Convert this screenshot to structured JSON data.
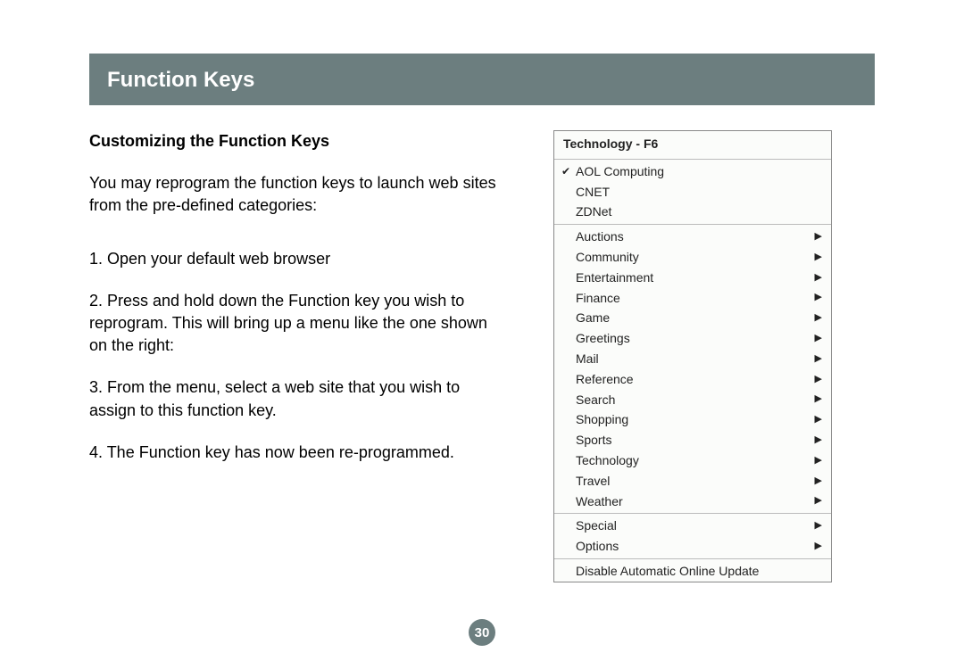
{
  "header": {
    "title": "Function Keys"
  },
  "subtitle": "Customizing the Function Keys",
  "intro": "You may reprogram the function keys to launch web sites from the pre-defined categories:",
  "steps": [
    "1. Open your default web browser",
    "2. Press and hold down the Function key you wish to reprogram. This will bring up a menu like the one shown on the right:",
    "3. From the menu, select a web site that you wish to assign to this function key.",
    "4. The Function key has now been re-programmed."
  ],
  "menu": {
    "title": "Technology - F6",
    "topItems": [
      {
        "label": "AOL Computing",
        "checked": true
      },
      {
        "label": "CNET",
        "checked": false
      },
      {
        "label": "ZDNet",
        "checked": false
      }
    ],
    "categories": [
      "Auctions",
      "Community",
      "Entertainment",
      "Finance",
      "Game",
      "Greetings",
      "Mail",
      "Reference",
      "Search",
      "Shopping",
      "Sports",
      "Technology",
      "Travel",
      "Weather"
    ],
    "bottomItems": [
      "Special",
      "Options"
    ],
    "footer": "Disable Automatic Online Update"
  },
  "pageNumber": "30"
}
